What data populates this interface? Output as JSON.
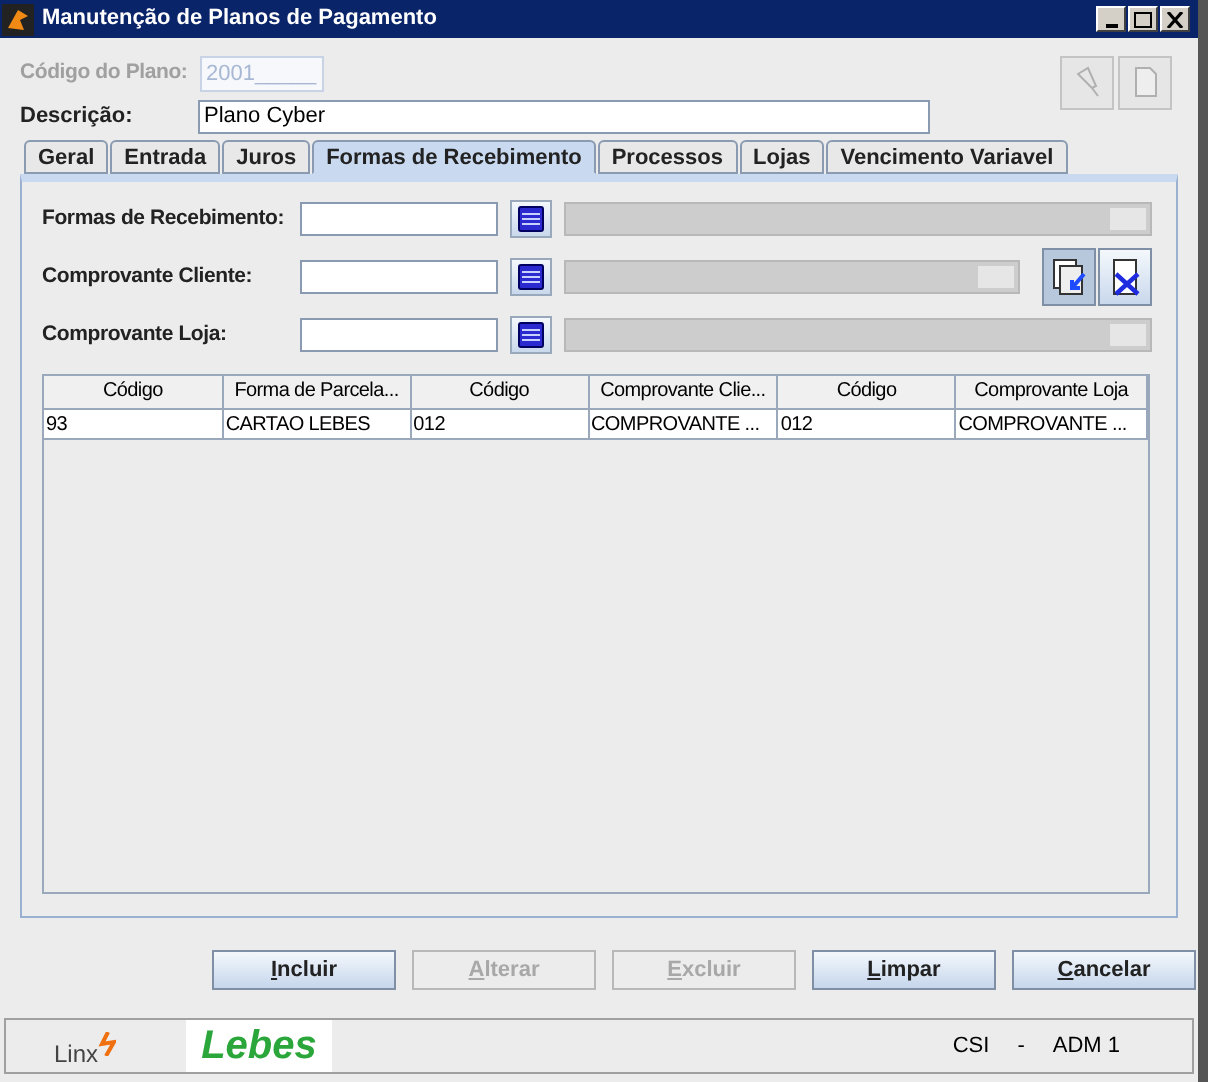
{
  "window": {
    "title": "Manutenção de Planos de Pagamento"
  },
  "plan_code": {
    "label": "Código do Plano:",
    "value": "2001_____",
    "disabled": true
  },
  "description": {
    "label": "Descrição:",
    "value": "Plano Cyber"
  },
  "tabs": [
    {
      "label": "Geral",
      "selected": false
    },
    {
      "label": "Entrada",
      "selected": false
    },
    {
      "label": "Juros",
      "selected": false
    },
    {
      "label": "Formas de Recebimento",
      "selected": true
    },
    {
      "label": "Processos",
      "selected": false
    },
    {
      "label": "Lojas",
      "selected": false
    },
    {
      "label": "Vencimento Variavel",
      "selected": false
    }
  ],
  "fields": [
    {
      "label": "Formas de Recebimento:",
      "actions": false
    },
    {
      "label": "Comprovante Cliente:",
      "actions": true
    },
    {
      "label": "Comprovante Loja:",
      "actions": false
    }
  ],
  "table": {
    "columns": [
      "Código",
      "Forma de Parcela...",
      "Código",
      "Comprovante Clie...",
      "Código",
      "Comprovante Loja"
    ],
    "rows": [
      [
        "93",
        "CARTAO LEBES",
        "012",
        "COMPROVANTE ...",
        "012",
        "COMPROVANTE ..."
      ]
    ]
  },
  "buttons": [
    {
      "label": "Incluir",
      "disabled": false
    },
    {
      "label": "Alterar",
      "disabled": true
    },
    {
      "label": "Excluir",
      "disabled": true
    },
    {
      "label": "Limpar",
      "disabled": false
    },
    {
      "label": "Cancelar",
      "disabled": false
    }
  ],
  "status_bar": {
    "logo_1": "Linx",
    "logo_2": "Lebes",
    "user": "CSI",
    "separator": "-",
    "role": "ADM 1"
  }
}
